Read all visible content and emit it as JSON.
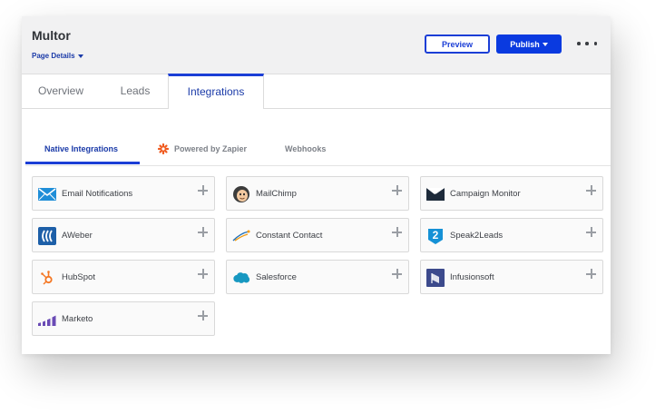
{
  "header": {
    "title": "Multor",
    "page_details_label": "Page Details",
    "preview_label": "Preview",
    "publish_label": "Publish"
  },
  "tabs": [
    {
      "label": "Overview",
      "active": false
    },
    {
      "label": "Leads",
      "active": false
    },
    {
      "label": "Integrations",
      "active": true
    }
  ],
  "subtabs": [
    {
      "label": "Native Integrations",
      "active": true
    },
    {
      "label": "Powered by Zapier",
      "icon": "zapier-icon",
      "active": false
    },
    {
      "label": "Webhooks",
      "active": false
    }
  ],
  "integrations": [
    {
      "label": "Email Notifications",
      "icon": "email-icon"
    },
    {
      "label": "MailChimp",
      "icon": "mailchimp-icon"
    },
    {
      "label": "Campaign Monitor",
      "icon": "campaign-monitor-icon"
    },
    {
      "label": "AWeber",
      "icon": "aweber-icon"
    },
    {
      "label": "Constant Contact",
      "icon": "constant-contact-icon"
    },
    {
      "label": "Speak2Leads",
      "icon": "speak2leads-icon"
    },
    {
      "label": "HubSpot",
      "icon": "hubspot-icon"
    },
    {
      "label": "Salesforce",
      "icon": "salesforce-icon"
    },
    {
      "label": "Infusionsoft",
      "icon": "infusionsoft-icon"
    },
    {
      "label": "Marketo",
      "icon": "marketo-icon"
    }
  ],
  "colors": {
    "accent": "#1b3ed6",
    "publish": "#0a3ae0",
    "header_bg": "#f1f1f2"
  }
}
